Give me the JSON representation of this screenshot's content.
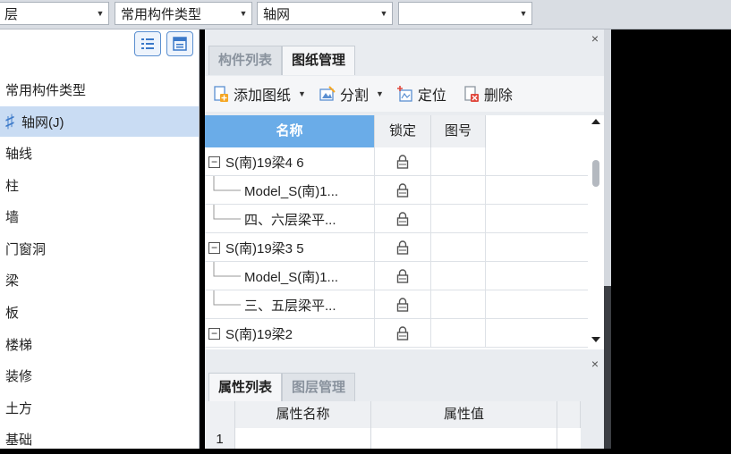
{
  "topbar": {
    "combos": [
      {
        "value": "层"
      },
      {
        "value": "常用构件类型"
      },
      {
        "value": "轴网"
      },
      {
        "value": ""
      }
    ]
  },
  "left": {
    "items": [
      {
        "label": "常用构件类型"
      },
      {
        "label": "轴网(J)"
      },
      {
        "label": "轴线"
      },
      {
        "label": "柱"
      },
      {
        "label": "墙"
      },
      {
        "label": "门窗洞"
      },
      {
        "label": "梁"
      },
      {
        "label": "板"
      },
      {
        "label": "楼梯"
      },
      {
        "label": "装修"
      },
      {
        "label": "土方"
      },
      {
        "label": "基础"
      }
    ]
  },
  "drawing_panel": {
    "close": "×",
    "tabs": [
      {
        "label": "构件列表"
      },
      {
        "label": "图纸管理"
      }
    ],
    "toolbar": {
      "add": "添加图纸",
      "split": "分割",
      "locate": "定位",
      "delete": "删除"
    },
    "columns": {
      "name": "名称",
      "lock": "锁定",
      "number": "图号"
    },
    "rows": [
      {
        "name": "S(南)19梁4 6",
        "expander": "−"
      },
      {
        "name": "Model_S(南)1..."
      },
      {
        "name": "四、六层梁平..."
      },
      {
        "name": "S(南)19梁3 5",
        "expander": "−"
      },
      {
        "name": "Model_S(南)1..."
      },
      {
        "name": "三、五层梁平..."
      },
      {
        "name": "S(南)19梁2",
        "expander": "−"
      }
    ]
  },
  "property_panel": {
    "close": "×",
    "tabs": [
      {
        "label": "属性列表"
      },
      {
        "label": "图层管理"
      }
    ],
    "columns": {
      "name": "属性名称",
      "value": "属性值"
    },
    "rows": [
      {
        "index": "1"
      }
    ]
  },
  "colors": {
    "header_blue": "#6aace8",
    "selection": "#c9dcf3",
    "accent": "#3b79c9"
  }
}
